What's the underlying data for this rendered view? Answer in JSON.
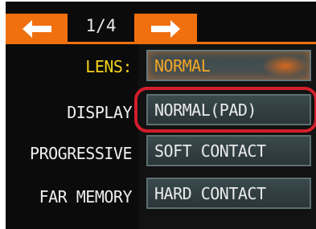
{
  "header": {
    "page_indicator": "1/4",
    "prev_icon": "left-arrow-icon",
    "next_icon": "right-arrow-icon"
  },
  "rows": [
    {
      "label": "LENS:",
      "value": "NORMAL"
    },
    {
      "label": "DISPLAY",
      "value": "NORMAL(PAD)"
    },
    {
      "label": "PROGRESSIVE",
      "value": "SOFT CONTACT"
    },
    {
      "label": "FAR MEMORY",
      "value": "HARD CONTACT"
    }
  ],
  "colors": {
    "accent": "#f0700f",
    "active_label": "#f5d21a",
    "selected_text": "#f5a623",
    "highlight_ring": "#d21e2b"
  }
}
